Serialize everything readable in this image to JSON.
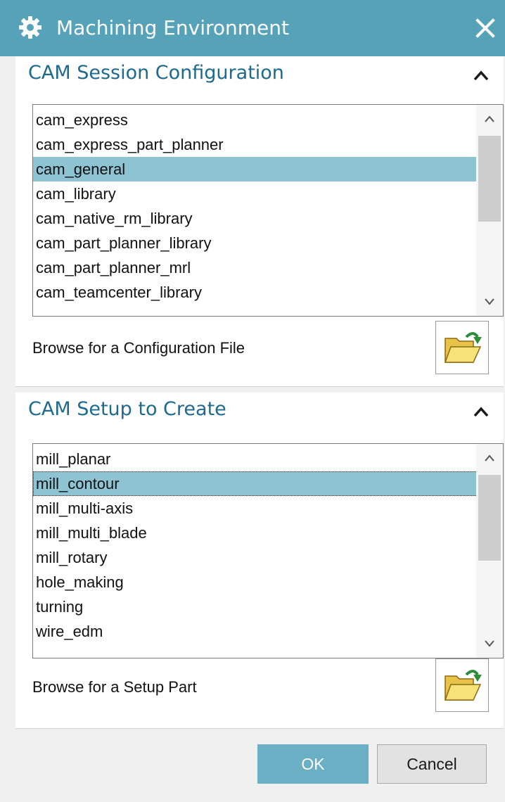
{
  "window": {
    "title": "Machining Environment",
    "icons": {
      "title": "gear-icon",
      "close": "close-icon"
    }
  },
  "colors": {
    "titlebar": "#56a3b9",
    "section_title": "#1d6a8e",
    "selection": "#8ec3d4",
    "ok_button": "#6aafc3"
  },
  "session_config": {
    "title": "CAM Session Configuration",
    "items": [
      "cam_express",
      "cam_express_part_planner",
      "cam_general",
      "cam_library",
      "cam_native_rm_library",
      "cam_part_planner_library",
      "cam_part_planner_mrl",
      "cam_teamcenter_library"
    ],
    "selected": "cam_general",
    "browse_label": "Browse for a Configuration File",
    "browse_icon": "open-folder-icon"
  },
  "setup": {
    "title": "CAM Setup to Create",
    "items": [
      "mill_planar",
      "mill_contour",
      "mill_multi-axis",
      "mill_multi_blade",
      "mill_rotary",
      "hole_making",
      "turning",
      "wire_edm"
    ],
    "selected": "mill_contour",
    "browse_label": "Browse for a Setup Part",
    "browse_icon": "open-folder-icon"
  },
  "buttons": {
    "ok": "OK",
    "cancel": "Cancel"
  }
}
